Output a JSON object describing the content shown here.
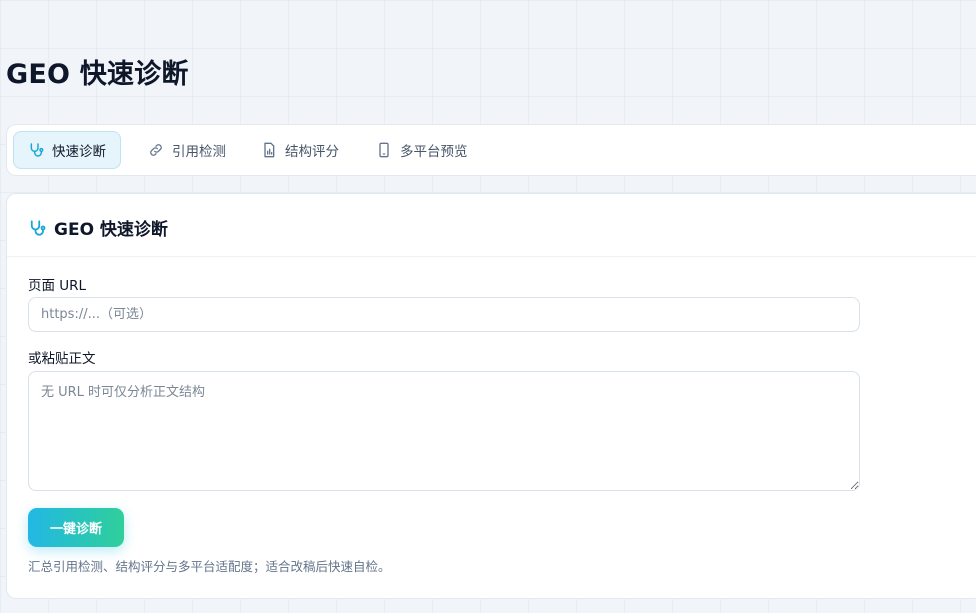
{
  "page": {
    "title": "GEO 快速诊断"
  },
  "colors": {
    "accent": "#22b8e4",
    "accent_end": "#2fcf9a",
    "active_tab_bg": "#e6f4fb",
    "text": "#0f172a",
    "muted": "#64748b"
  },
  "tabs": [
    {
      "label": "快速诊断",
      "icon": "stethoscope-icon",
      "active": true
    },
    {
      "label": "引用检测",
      "icon": "link-icon",
      "active": false
    },
    {
      "label": "结构评分",
      "icon": "bar-chart-file-icon",
      "active": false
    },
    {
      "label": "多平台预览",
      "icon": "phone-icon",
      "active": false
    }
  ],
  "card": {
    "title": "GEO 快速诊断",
    "title_icon": "stethoscope-icon",
    "url_label": "页面 URL",
    "url_placeholder": "https://...（可选）",
    "url_value": "",
    "body_label": "或粘贴正文",
    "body_placeholder": "无 URL 时可仅分析正文结构",
    "body_value": "",
    "button_label": "一键诊断",
    "hint": "汇总引用检测、结构评分与多平台适配度；适合改稿后快速自检。"
  }
}
